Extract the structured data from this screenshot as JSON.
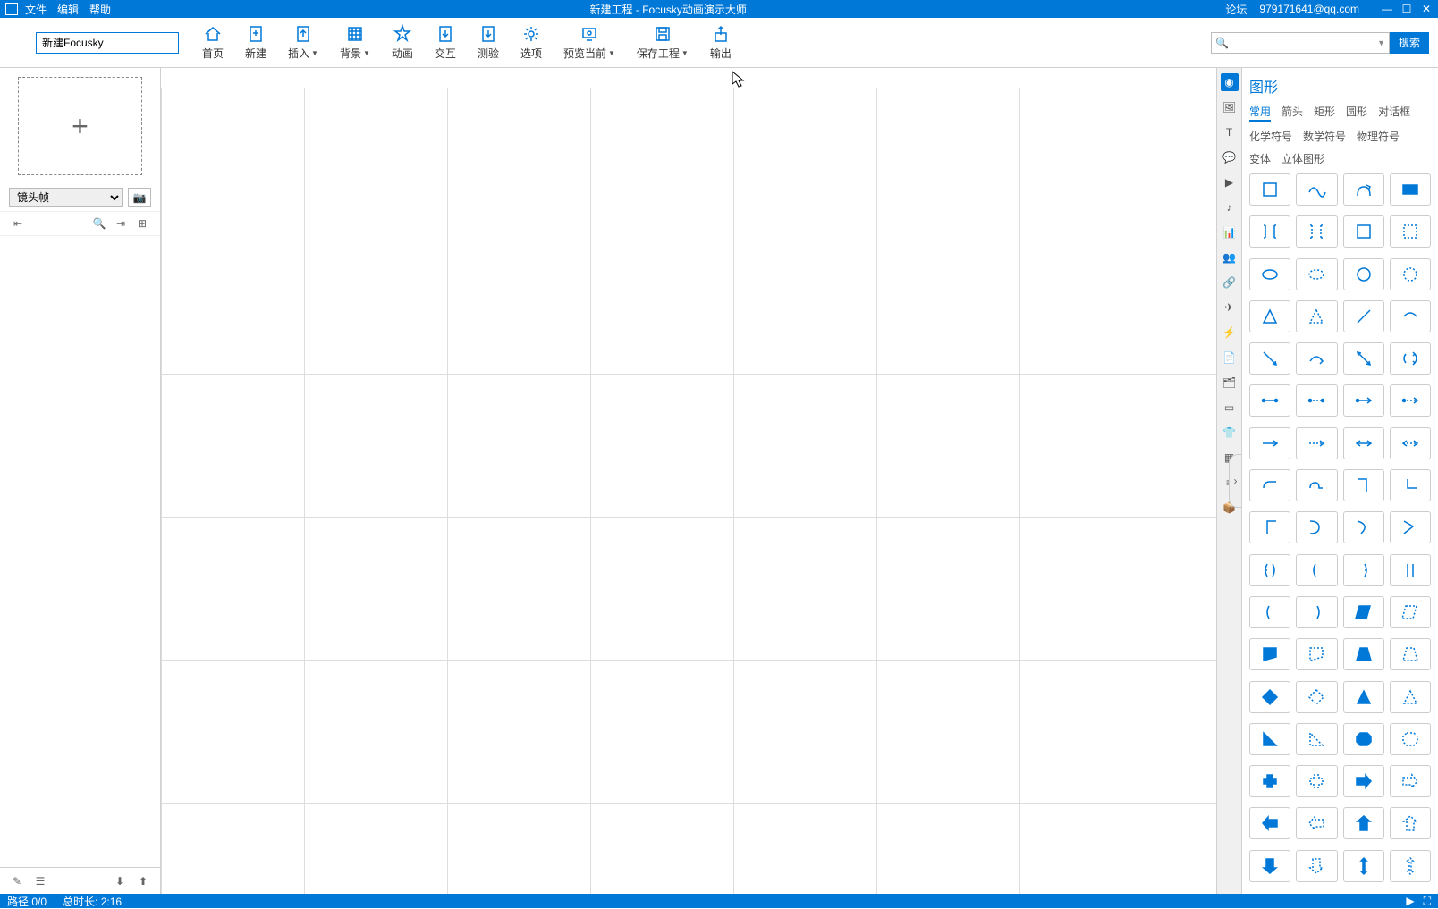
{
  "titlebar": {
    "menus": [
      "文件",
      "编辑",
      "帮助"
    ],
    "title": "新建工程 - Focusky动画演示大师",
    "forum": "论坛",
    "user": "979171641@qq.com"
  },
  "titlebox": {
    "value": "新建Focusky"
  },
  "ribbon": [
    {
      "key": "home",
      "label": "首页"
    },
    {
      "key": "new",
      "label": "新建"
    },
    {
      "key": "insert",
      "label": "插入",
      "caret": true
    },
    {
      "key": "background",
      "label": "背景",
      "caret": true
    },
    {
      "key": "animation",
      "label": "动画"
    },
    {
      "key": "interact",
      "label": "交互"
    },
    {
      "key": "quiz",
      "label": "测验"
    },
    {
      "key": "options",
      "label": "选项"
    },
    {
      "key": "preview",
      "label": "预览当前",
      "caret": true
    },
    {
      "key": "save",
      "label": "保存工程",
      "caret": true
    },
    {
      "key": "export",
      "label": "输出"
    }
  ],
  "search": {
    "placeholder": "",
    "button": "搜索"
  },
  "frame": {
    "type": "镜头帧"
  },
  "shapepanel": {
    "title": "图形",
    "tabs": [
      "常用",
      "箭头",
      "矩形",
      "圆形",
      "对话框",
      "化学符号",
      "数学符号",
      "物理符号",
      "变体",
      "立体图形"
    ],
    "active": "常用"
  },
  "status": {
    "path": "路径 0/0",
    "duration": "总时长: 2:16"
  }
}
